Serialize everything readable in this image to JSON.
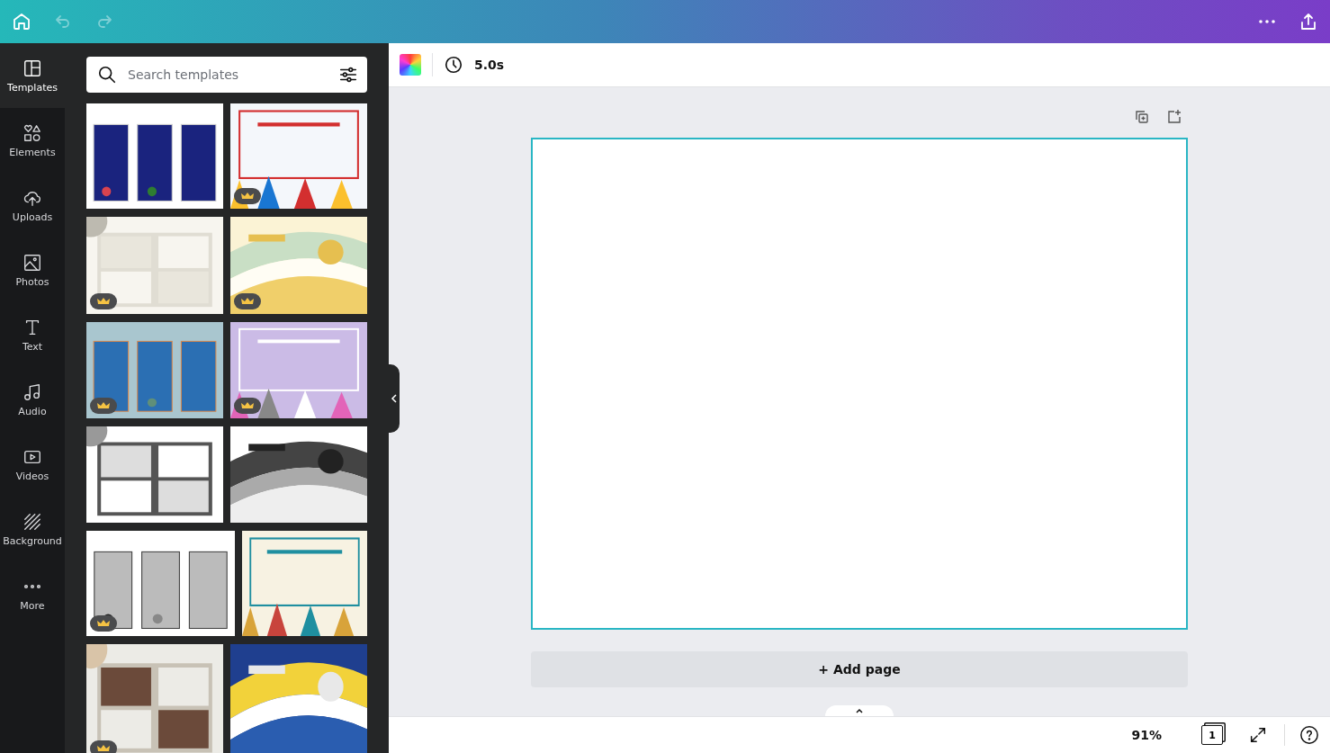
{
  "top_bar": {
    "undo_disabled": true,
    "redo_disabled": true
  },
  "sidebar": {
    "items": [
      {
        "label": "Templates",
        "selected": true
      },
      {
        "label": "Elements",
        "selected": false
      },
      {
        "label": "Uploads",
        "selected": false
      },
      {
        "label": "Photos",
        "selected": false
      },
      {
        "label": "Text",
        "selected": false
      },
      {
        "label": "Audio",
        "selected": false
      },
      {
        "label": "Videos",
        "selected": false
      },
      {
        "label": "Background",
        "selected": false
      },
      {
        "label": "More",
        "selected": false
      }
    ]
  },
  "templates_panel": {
    "search": {
      "placeholder": "Search templates"
    },
    "rows": [
      {
        "items": [
          {
            "kind": "picture",
            "premium": false
          },
          {
            "kind": "picture",
            "premium": true
          }
        ]
      },
      {
        "items": [
          {
            "kind": "picture",
            "premium": true
          },
          {
            "kind": "picture",
            "premium": true
          }
        ]
      },
      {
        "items": [
          {
            "kind": "picture",
            "premium": true
          },
          {
            "kind": "picture",
            "premium": true
          }
        ]
      },
      {
        "items": [
          {
            "kind": "picture",
            "premium": false
          },
          {
            "kind": "picture",
            "premium": false
          }
        ]
      },
      {
        "items": [
          {
            "kind": "picture",
            "premium": true
          },
          {
            "kind": "picture",
            "premium": false
          }
        ]
      },
      {
        "items": [
          {
            "kind": "picture",
            "premium": true
          },
          {
            "kind": "picture",
            "premium": false
          }
        ]
      }
    ]
  },
  "toolbar": {
    "duration": "5.0s"
  },
  "canvas": {
    "add_page": "+ Add page"
  },
  "status_bar": {
    "zoom": "91%",
    "page_count": "1"
  }
}
